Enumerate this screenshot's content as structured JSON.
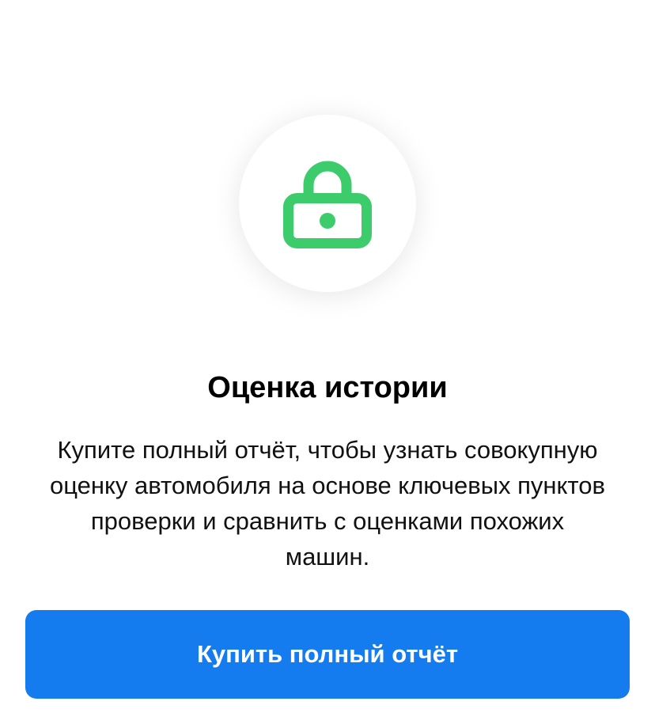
{
  "icon": {
    "name": "lock-icon",
    "color": "#3ccc6b"
  },
  "title": "Оценка истории",
  "description": "Купите полный отчёт, чтобы узнать совокупную оценку автомобиля на основе ключевых пунктов проверки и сравнить с оценками похожих машин.",
  "button": {
    "label": "Купить полный отчёт",
    "color": "#157cf0"
  }
}
